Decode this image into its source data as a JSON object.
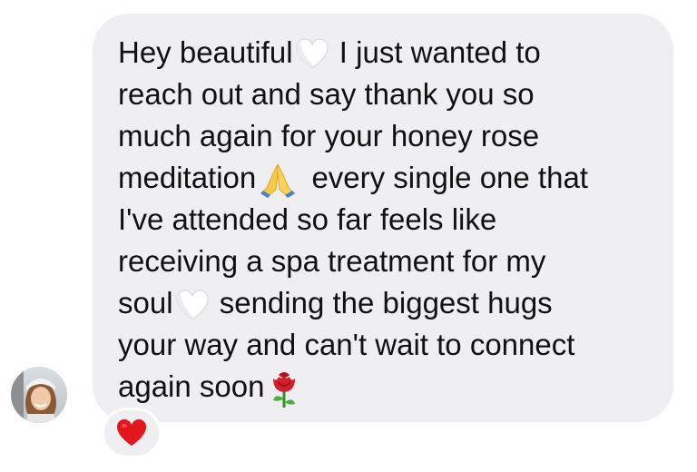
{
  "message": {
    "lines": [
      [
        "Hey beautiful",
        "I just wanted to"
      ],
      [
        "reach out and say thank you so"
      ],
      [
        "much again for your honey rose"
      ],
      [
        "meditation",
        "every single one that"
      ],
      [
        "I've attended so far feels like"
      ],
      [
        "receiving a spa treatment for my"
      ],
      [
        "soul",
        "sending the biggest hugs"
      ],
      [
        "your way and can't wait to connect"
      ],
      [
        "again soon"
      ]
    ],
    "emojis": [
      "white-heart-icon",
      "folded-hands-icon",
      "white-heart-icon",
      "rose-icon"
    ]
  },
  "reaction": {
    "icon": "red-heart-icon"
  },
  "colors": {
    "bubble": "#efeff2",
    "text": "#111111",
    "reaction_heart": "#e3161c"
  }
}
